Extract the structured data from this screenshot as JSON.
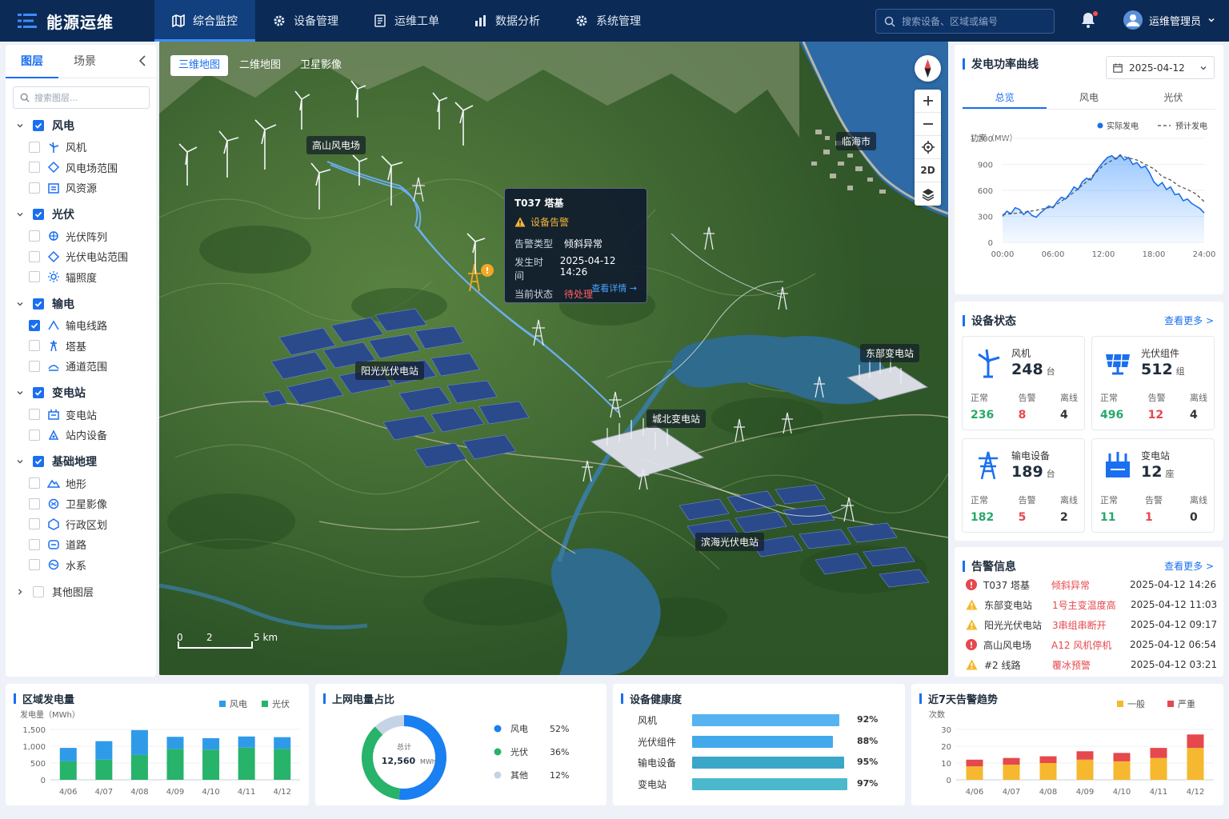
{
  "app": {
    "title": "能源运维"
  },
  "nav": [
    "综合监控",
    "设备管理",
    "运维工单",
    "数据分析",
    "系统管理"
  ],
  "search": {
    "placeholder": "搜索设备、区域或编号"
  },
  "user": {
    "name": "运维管理员"
  },
  "left": {
    "tabs": [
      "图层",
      "场景"
    ],
    "search_placeholder": "搜索图层...",
    "groups": [
      {
        "label": "风电",
        "checked": true,
        "items": [
          {
            "label": "风机",
            "icon": "wind-turbine-icon"
          },
          {
            "label": "风电场范围",
            "icon": "area-icon"
          },
          {
            "label": "风资源",
            "icon": "wind-resource-icon"
          }
        ]
      },
      {
        "label": "光伏",
        "checked": true,
        "items": [
          {
            "label": "光伏阵列",
            "icon": "pv-array-icon"
          },
          {
            "label": "光伏电站范围",
            "icon": "area-icon"
          },
          {
            "label": "辐照度",
            "icon": "irradiance-icon"
          }
        ]
      },
      {
        "label": "输电",
        "checked": true,
        "items": [
          {
            "label": "输电线路",
            "icon": "line-icon",
            "checked": true
          },
          {
            "label": "塔基",
            "icon": "tower-icon"
          },
          {
            "label": "通道范围",
            "icon": "channel-icon"
          }
        ]
      },
      {
        "label": "变电站",
        "checked": true,
        "items": [
          {
            "label": "变电站",
            "icon": "substation-icon"
          },
          {
            "label": "站内设备",
            "icon": "station-device-icon"
          }
        ]
      },
      {
        "label": "基础地理",
        "checked": true,
        "items": [
          {
            "label": "地形",
            "icon": "terrain-icon"
          },
          {
            "label": "卫星影像",
            "icon": "satellite-icon"
          },
          {
            "label": "行政区划",
            "icon": "district-icon"
          },
          {
            "label": "道路",
            "icon": "road-icon"
          },
          {
            "label": "水系",
            "icon": "water-icon"
          }
        ]
      }
    ],
    "other": "其他图层"
  },
  "map": {
    "tabs": [
      "三维地图",
      "二维地图",
      "卫星影像"
    ],
    "labels": {
      "wind_farm": "高山风电场",
      "city": "临海市",
      "solar1": "阳光光伏电站",
      "east_sub": "东部变电站",
      "north_sub": "城北变电站",
      "solar2": "滨海光伏电站"
    },
    "tooltip": {
      "title": "T037 塔基",
      "status": "设备告警",
      "type_label": "告警类型",
      "type_value": "倾斜异常",
      "time_label": "发生时间",
      "time_value": "2025-04-12 14:26",
      "state_label": "当前状态",
      "state_value": "待处理",
      "more": "查看详情 →"
    },
    "view_mode": "2D",
    "scale": {
      "t0": "0",
      "t1": "2",
      "t2": "5 km"
    }
  },
  "power": {
    "title": "发电功率曲线",
    "date": "2025-04-12",
    "tabs": [
      "总览",
      "风电",
      "光伏"
    ],
    "legend_actual": "实际发电",
    "legend_forecast": "预计发电",
    "ylabel": "功率（MW）"
  },
  "devices": {
    "title": "设备状态",
    "more": "查看更多 >",
    "status_labels": [
      "正常",
      "告警",
      "离线"
    ],
    "cards": [
      {
        "name": "风机",
        "count": "248",
        "unit": "台",
        "normal": "236",
        "alarm": "8",
        "offline": "4",
        "icon": "wind-turbine-icon"
      },
      {
        "name": "光伏组件",
        "count": "512",
        "unit": "组",
        "normal": "496",
        "alarm": "12",
        "offline": "4",
        "icon": "solar-panel-icon"
      },
      {
        "name": "输电设备",
        "count": "189",
        "unit": "台",
        "normal": "182",
        "alarm": "5",
        "offline": "2",
        "icon": "tower-icon"
      },
      {
        "name": "变电站",
        "count": "12",
        "unit": "座",
        "normal": "11",
        "alarm": "1",
        "offline": "0",
        "icon": "substation-icon"
      }
    ]
  },
  "alarms": {
    "title": "告警信息",
    "more": "查看更多 >",
    "rows": [
      {
        "device": "T037 塔基",
        "type": "倾斜异常",
        "time": "2025-04-12 14:26",
        "level": "severe"
      },
      {
        "device": "东部变电站",
        "type": "1号主变温度高",
        "time": "2025-04-12 11:03",
        "level": "warning"
      },
      {
        "device": "阳光光伏电站",
        "type": "3串组串断开",
        "time": "2025-04-12 09:17",
        "level": "warning"
      },
      {
        "device": "高山风电场",
        "type": "A12 风机停机",
        "time": "2025-04-12 06:54",
        "level": "severe"
      },
      {
        "device": "#2 线路",
        "type": "覆冰预警",
        "time": "2025-04-12 03:21",
        "level": "warning"
      }
    ]
  },
  "bottom": {
    "regional_title": "区域发电量",
    "share_title": "上网电量占比",
    "health_title": "设备健康度",
    "trend_title": "近7天告警趋势",
    "share_center_label": "总计",
    "share_center_value": "12,560",
    "share_center_unit": "MWh"
  },
  "colors": {
    "wind": "#2f9be8",
    "solar": "#27b36a",
    "other": "#c5d3e6",
    "general_alarm": "#f5b82e",
    "severe_alarm": "#e5484d",
    "accent": "#1a6ff0"
  },
  "chart_data": [
    {
      "type": "area",
      "id": "power-curve",
      "ylabel": "功率（MW）",
      "x_ticks": [
        "00:00",
        "06:00",
        "12:00",
        "18:00",
        "24:00"
      ],
      "y_ticks": [
        0,
        300,
        600,
        900,
        1200
      ],
      "ylim": [
        0,
        1200
      ],
      "xlim": [
        0,
        24
      ],
      "series": [
        {
          "name": "实际发电",
          "style": "solid",
          "x": [
            0,
            0.5,
            1,
            1.5,
            2,
            2.5,
            3,
            3.5,
            4,
            4.5,
            5,
            5.5,
            6,
            6.5,
            7,
            7.5,
            8,
            8.5,
            9,
            9.5,
            10,
            10.5,
            11,
            11.5,
            12,
            12.5,
            13,
            13.5,
            14,
            14.5,
            15,
            15.5,
            16,
            16.5,
            17,
            17.5,
            18,
            18.5,
            19,
            19.5,
            20,
            20.5,
            21,
            21.5,
            22,
            22.5,
            23,
            23.5,
            24
          ],
          "y": [
            300,
            360,
            330,
            400,
            380,
            320,
            360,
            310,
            290,
            340,
            380,
            420,
            400,
            470,
            520,
            500,
            560,
            640,
            610,
            700,
            740,
            720,
            800,
            870,
            930,
            980,
            1000,
            960,
            1010,
            950,
            980,
            900,
            920,
            860,
            880,
            800,
            700,
            650,
            690,
            610,
            640,
            550,
            560,
            480,
            500,
            450,
            420,
            390,
            340
          ]
        },
        {
          "name": "预计发电",
          "style": "dashed",
          "x": [
            0,
            2,
            4,
            6,
            8,
            10,
            12,
            14,
            16,
            18,
            19,
            20,
            21,
            22,
            23,
            24
          ],
          "y": [
            320,
            340,
            370,
            410,
            540,
            700,
            890,
            1000,
            950,
            850,
            760,
            720,
            650,
            610,
            560,
            470
          ]
        }
      ]
    },
    {
      "type": "bar",
      "id": "regional-generation",
      "title": "区域发电量",
      "ylabel": "发电量（MWh）",
      "categories": [
        "4/06",
        "4/07",
        "4/08",
        "4/09",
        "4/10",
        "4/11",
        "4/12"
      ],
      "y_ticks": [
        "0",
        "500",
        "1,000",
        "1,500"
      ],
      "ylim": [
        0,
        1500
      ],
      "stacked": true,
      "series": [
        {
          "name": "光伏",
          "values": [
            550,
            600,
            740,
            920,
            900,
            960,
            920
          ]
        },
        {
          "name": "风电",
          "values": [
            950,
            1150,
            1480,
            1280,
            1240,
            1290,
            1270
          ]
        }
      ]
    },
    {
      "type": "pie",
      "id": "grid-share",
      "title": "上网电量占比",
      "labels": [
        "风电",
        "光伏",
        "其他"
      ],
      "values": [
        52,
        36,
        12
      ],
      "display": [
        "52%",
        "36%",
        "12%"
      ]
    },
    {
      "type": "bar",
      "id": "device-health",
      "orientation": "horizontal",
      "title": "设备健康度",
      "categories": [
        "风机",
        "光伏组件",
        "输电设备",
        "变电站"
      ],
      "values": [
        92,
        88,
        95,
        97
      ],
      "display": [
        "92%",
        "88%",
        "95%",
        "97%"
      ],
      "xlim": [
        0,
        100
      ]
    },
    {
      "type": "bar",
      "id": "alarm-trend",
      "title": "近7天告警趋势",
      "ylabel": "次数",
      "categories": [
        "4/06",
        "4/07",
        "4/08",
        "4/09",
        "4/10",
        "4/11",
        "4/12"
      ],
      "y_ticks": [
        0,
        10,
        20,
        30
      ],
      "ylim": [
        0,
        30
      ],
      "stacked": true,
      "series": [
        {
          "name": "一般",
          "values": [
            8,
            9,
            10,
            12,
            11,
            13,
            19
          ]
        },
        {
          "name": "严重",
          "values": [
            4,
            4,
            4,
            5,
            5,
            6,
            8
          ]
        }
      ]
    }
  ]
}
